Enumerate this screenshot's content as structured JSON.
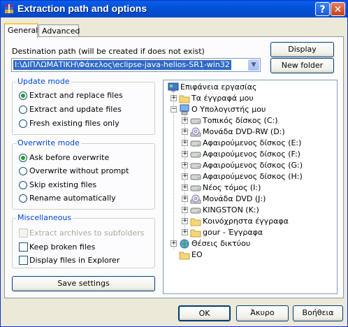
{
  "window": {
    "title": "Extraction path and options",
    "help_label": "?",
    "close_label": "✕"
  },
  "tabs": [
    {
      "label": "General"
    },
    {
      "label": "Advanced"
    }
  ],
  "destination": {
    "label": "Destination path (will be created if does not exist)",
    "value": "I:\\ΔΙΠΛΩΜΑΤΙΚΗ\\Φάκελος\\eclipse-java-helios-SR1-win32",
    "display_label": "Display",
    "new_folder_label": "New folder"
  },
  "update_mode": {
    "title": "Update mode",
    "options": [
      {
        "label": "Extract and replace files",
        "selected": true
      },
      {
        "label": "Extract and update files",
        "selected": false
      },
      {
        "label": "Fresh existing files only",
        "selected": false
      }
    ]
  },
  "overwrite_mode": {
    "title": "Overwrite mode",
    "options": [
      {
        "label": "Ask before overwrite",
        "selected": true
      },
      {
        "label": "Overwrite without prompt",
        "selected": false
      },
      {
        "label": "Skip existing files",
        "selected": false
      },
      {
        "label": "Rename automatically",
        "selected": false
      }
    ]
  },
  "misc": {
    "title": "Miscellaneous",
    "options": [
      {
        "label": "Extract archives to subfolders",
        "checked": false,
        "disabled": true
      },
      {
        "label": "Keep broken files",
        "checked": false,
        "disabled": false
      },
      {
        "label": "Display files in Explorer",
        "checked": false,
        "disabled": false
      }
    ]
  },
  "save_settings_label": "Save settings",
  "tree": {
    "items": [
      {
        "label": "Επιφάνεια εργασίας",
        "icon": "desktop-icon"
      },
      {
        "label": "Τα έγγραφά μου",
        "icon": "folder-icon"
      },
      {
        "label": "Ο Υπολογιστής μου",
        "icon": "computer-icon"
      },
      {
        "label": "Τοπικός δίσκος (C:)",
        "icon": "drive-icon"
      },
      {
        "label": "Μονάδα DVD-RW (D:)",
        "icon": "dvd-icon"
      },
      {
        "label": "Αφαιρούμενος δίσκος (E:)",
        "icon": "drive-icon"
      },
      {
        "label": "Αφαιρούμενος δίσκος (F:)",
        "icon": "drive-icon"
      },
      {
        "label": "Αφαιρούμενος δίσκος (G:)",
        "icon": "drive-icon"
      },
      {
        "label": "Αφαιρούμενος δίσκος (H:)",
        "icon": "drive-icon"
      },
      {
        "label": "Νέος τόμος (I:)",
        "icon": "drive-icon"
      },
      {
        "label": "Μονάδα DVD (J:)",
        "icon": "dvd-icon"
      },
      {
        "label": "KINGSTON (K:)",
        "icon": "drive-icon"
      },
      {
        "label": "Κοινόχρηστα έγγραφα",
        "icon": "folder-icon"
      },
      {
        "label": "gour - Έγγραφα",
        "icon": "folder-icon"
      },
      {
        "label": "Θέσεις δικτύου",
        "icon": "network-icon"
      },
      {
        "label": "EO",
        "icon": "folder-icon"
      }
    ]
  },
  "footer": {
    "ok_label": "OK",
    "cancel_label": "Άκυρο",
    "help_label": "Βοήθεια"
  },
  "colors": {
    "titlebar": "#0352d9",
    "accent_text": "#0046d5",
    "selection": "#316ac5",
    "radio_dot": "#21a121"
  }
}
